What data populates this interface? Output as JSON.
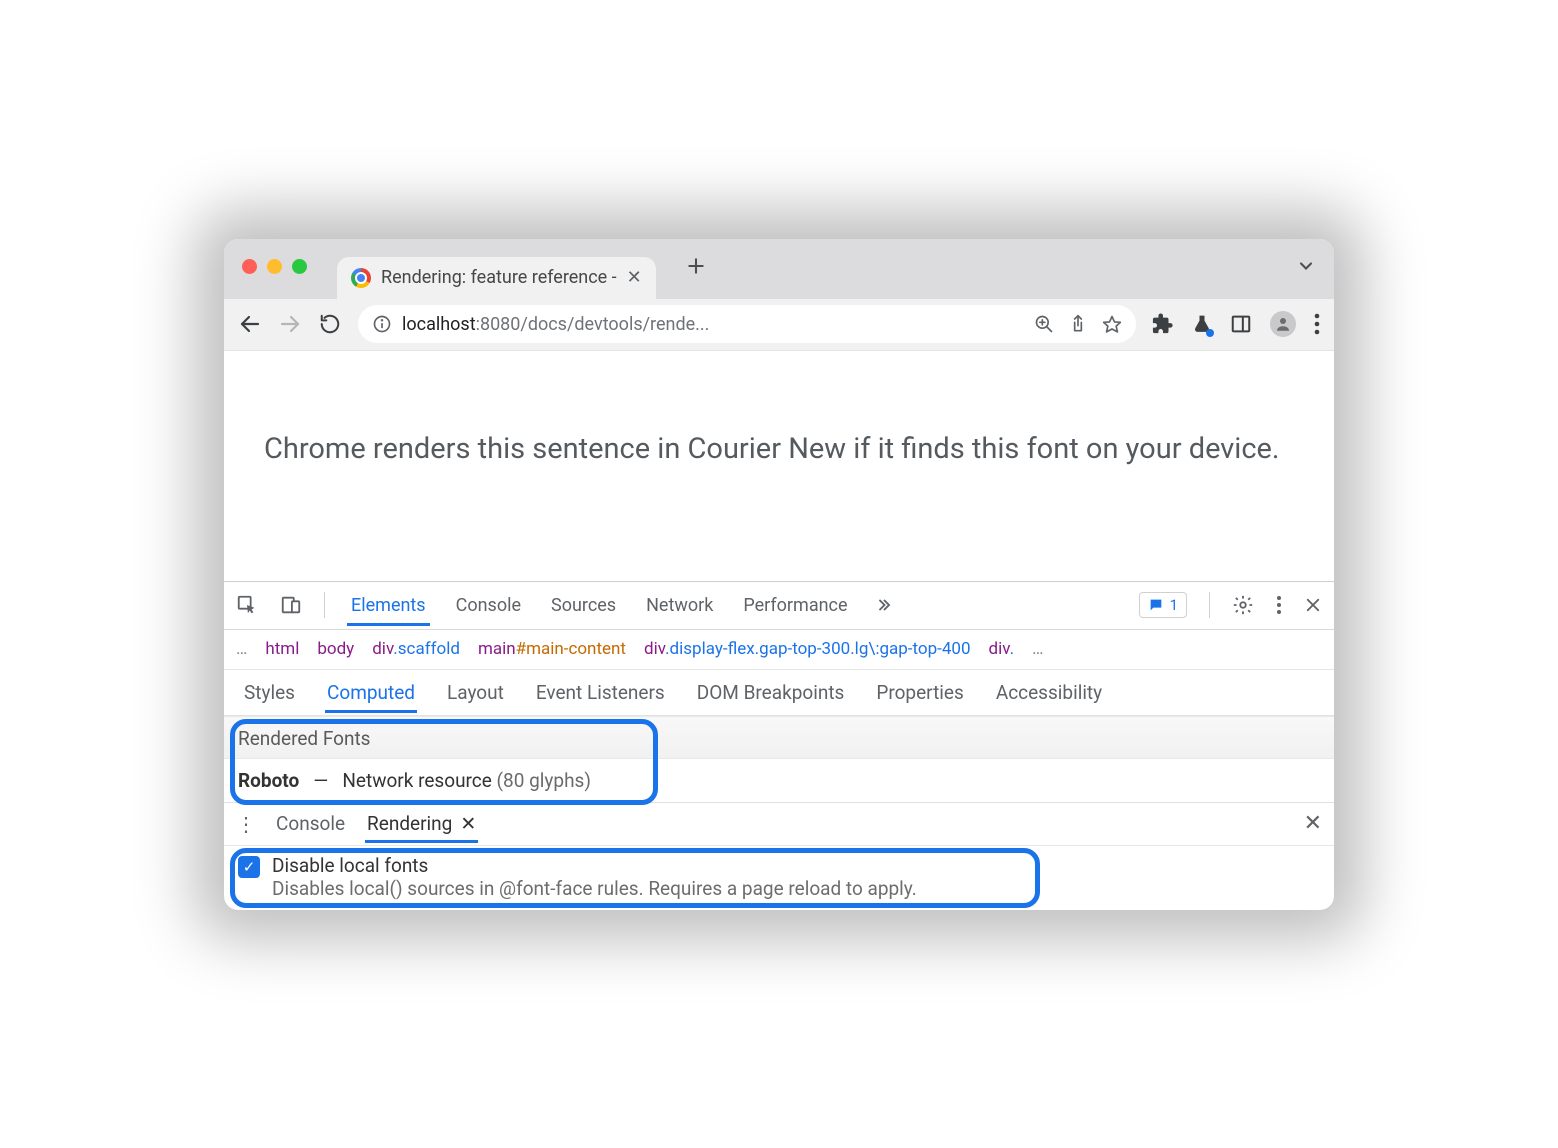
{
  "tab": {
    "title": "Rendering: feature reference -"
  },
  "url": {
    "host": "localhost",
    "port_path": ":8080/docs/devtools/rende..."
  },
  "page": {
    "sentence": "Chrome renders this sentence in Courier New if it finds this font on your device."
  },
  "devtools": {
    "tabs": [
      "Elements",
      "Console",
      "Sources",
      "Network",
      "Performance"
    ],
    "active_tab": "Elements",
    "issues_count": "1",
    "breadcrumb": {
      "items": [
        {
          "tag": "html",
          "cls": "",
          "id": ""
        },
        {
          "tag": "body",
          "cls": "",
          "id": ""
        },
        {
          "tag": "div",
          "cls": ".scaffold",
          "id": ""
        },
        {
          "tag": "main",
          "cls": "",
          "id": "#main-content"
        },
        {
          "tag": "div",
          "cls": ".display-flex.gap-top-300.lg\\:gap-top-400",
          "id": ""
        },
        {
          "tag": "div",
          "cls": ".",
          "id": ""
        }
      ]
    },
    "subtabs": [
      "Styles",
      "Computed",
      "Layout",
      "Event Listeners",
      "DOM Breakpoints",
      "Properties",
      "Accessibility"
    ],
    "active_subtab": "Computed",
    "rendered_fonts": {
      "heading": "Rendered Fonts",
      "font_name": "Roboto",
      "dash": "—",
      "source": "Network resource",
      "glyphs": "(80 glyphs)"
    },
    "drawer": {
      "tabs": [
        "Console",
        "Rendering"
      ],
      "active": "Rendering",
      "option_title": "Disable local fonts",
      "option_desc": "Disables local() sources in @font-face rules. Requires a page reload to apply."
    }
  }
}
